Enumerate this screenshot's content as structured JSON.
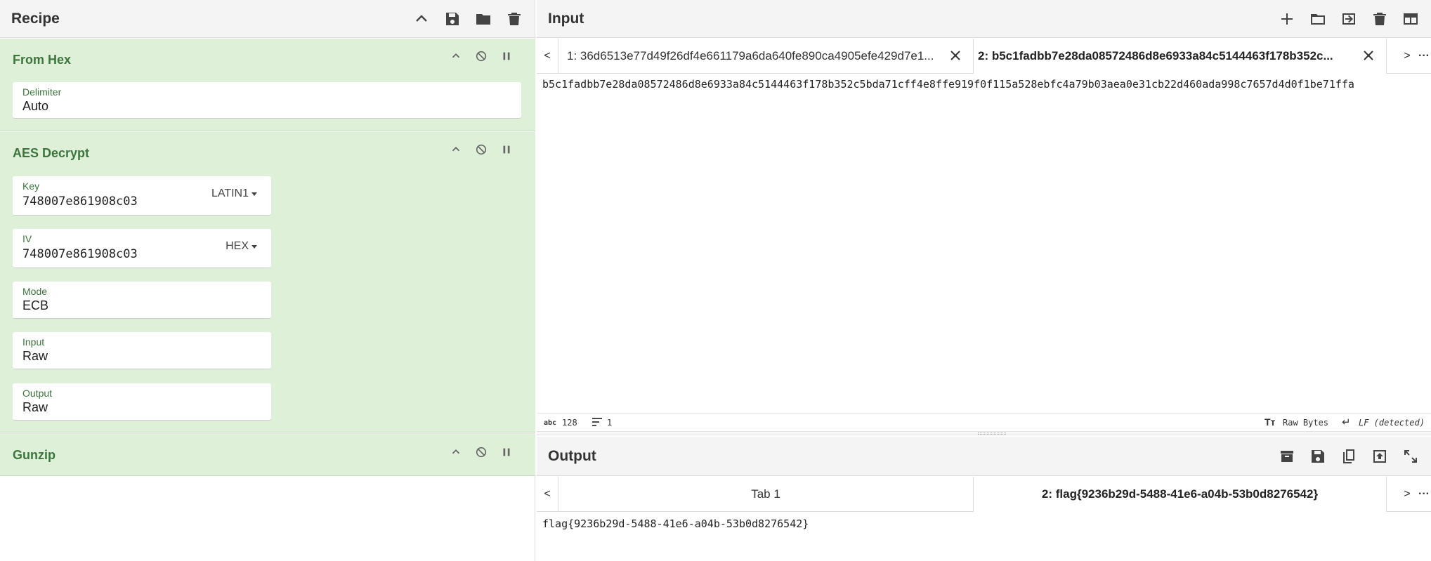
{
  "recipe": {
    "title": "Recipe",
    "icons": [
      "chevron-up-icon",
      "save-icon",
      "folder-icon",
      "trash-icon"
    ],
    "ops": [
      {
        "name": "From Hex",
        "args": [
          {
            "label": "Delimiter",
            "value": "Auto"
          }
        ]
      },
      {
        "name": "AES Decrypt",
        "args": [
          {
            "label": "Key",
            "value": "748007e861908c03",
            "option": "LATIN1"
          },
          {
            "label": "IV",
            "value": "748007e861908c03",
            "option": "HEX"
          },
          {
            "label": "Mode",
            "value": "ECB"
          },
          {
            "label": "Input",
            "value": "Raw"
          },
          {
            "label": "Output",
            "value": "Raw"
          }
        ]
      },
      {
        "name": "Gunzip",
        "args": []
      }
    ]
  },
  "input": {
    "title": "Input",
    "icons": [
      "plus-icon",
      "folder-icon",
      "import-icon",
      "trash-icon",
      "layout-icon"
    ],
    "tabs": [
      {
        "label": "1: 36d6513e77d49f26df4e661179a6da640fe890ca4905efe429d7e1..."
      },
      {
        "label": "2: b5c1fadbb7e28da08572486d8e6933a84c5144463f178b352c..."
      }
    ],
    "nav_prev": "<",
    "nav_next": ">",
    "more": "···",
    "text": "b5c1fadbb7e28da08572486d8e6933a84c5144463f178b352c5bda71cff4e8ffe919f0f115a528ebfc4a79b03aea0e31cb22d460ada998c7657d4d0f1be71ffa",
    "status": {
      "length_icon": "abc",
      "length": "128",
      "lines": "1",
      "encoding": "Raw Bytes",
      "eol": "LF (detected)"
    }
  },
  "output": {
    "title": "Output",
    "icons": [
      "archive-icon",
      "save-icon",
      "copy-icon",
      "upload-icon",
      "fullscreen-icon"
    ],
    "tabs": [
      {
        "label": "Tab 1"
      },
      {
        "label": "2: flag{9236b29d-5488-41e6-a04b-53b0d8276542}"
      }
    ],
    "nav_prev": "<",
    "nav_next": ">",
    "more": "···",
    "text": "flag{9236b29d-5488-41e6-a04b-53b0d8276542}"
  },
  "colors": {
    "op_bg": "#dff0d8",
    "op_title": "#3c763d",
    "header_bg": "#f4f4f4"
  }
}
